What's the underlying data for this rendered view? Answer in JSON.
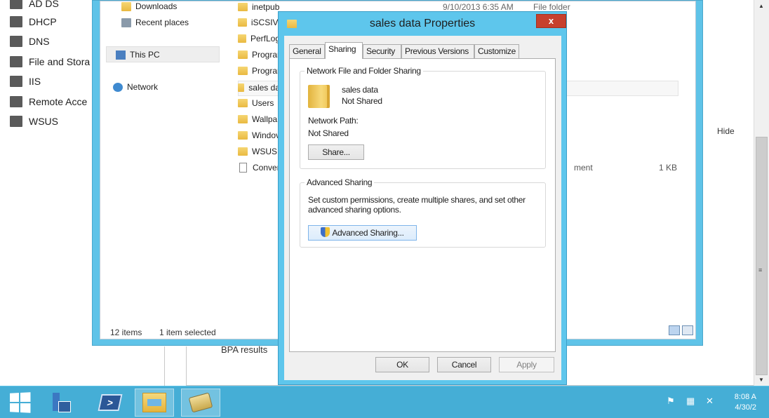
{
  "server_manager": {
    "nav_items": [
      {
        "label": "AD DS"
      },
      {
        "label": "DHCP"
      },
      {
        "label": "DNS"
      },
      {
        "label": "File and Stora"
      },
      {
        "label": "IIS"
      },
      {
        "label": "Remote Acce"
      },
      {
        "label": "WSUS"
      }
    ],
    "hide_label": "Hide",
    "bpa_label": "BPA results"
  },
  "explorer": {
    "nav": {
      "downloads": "Downloads",
      "recent_places": "Recent places",
      "this_pc": "This PC",
      "network": "Network"
    },
    "files": [
      {
        "name": "inetpub",
        "kind": "folder"
      },
      {
        "name": "iSCSIVi",
        "kind": "folder"
      },
      {
        "name": "PerfLog",
        "kind": "folder"
      },
      {
        "name": "Prograr",
        "kind": "folder"
      },
      {
        "name": "Prograr",
        "kind": "folder"
      },
      {
        "name": "sales da",
        "kind": "folder"
      },
      {
        "name": "Users",
        "kind": "folder"
      },
      {
        "name": "Wallpa",
        "kind": "folder"
      },
      {
        "name": "Windov",
        "kind": "folder"
      },
      {
        "name": "WSUS",
        "kind": "folder"
      },
      {
        "name": "Conver",
        "kind": "file"
      }
    ],
    "top_row_date": "9/10/2013 6:35 AM",
    "top_row_type": "File folder",
    "conv_type_partial": "ment",
    "conv_size": "1 KB",
    "status": {
      "item_count": "12 items",
      "selected": "1 item selected"
    }
  },
  "dialog": {
    "title": "sales data Properties",
    "close_glyph": "x",
    "tabs": [
      {
        "label": "General",
        "active": false
      },
      {
        "label": "Sharing",
        "active": true
      },
      {
        "label": "Security",
        "active": false
      },
      {
        "label": "Previous Versions",
        "active": false
      },
      {
        "label": "Customize",
        "active": false
      }
    ],
    "network_sharing": {
      "group_title": "Network File and Folder Sharing",
      "folder_name": "sales data",
      "share_state": "Not Shared",
      "path_label": "Network Path:",
      "path_value": "Not Shared",
      "share_button": "Share..."
    },
    "advanced_sharing": {
      "group_title": "Advanced Sharing",
      "description_line1": "Set custom permissions, create multiple shares, and set other",
      "description_line2": "advanced sharing options.",
      "button": "Advanced Sharing..."
    },
    "buttons": {
      "ok": "OK",
      "cancel": "Cancel",
      "apply": "Apply"
    }
  },
  "taskbar": {
    "apps": [
      {
        "name": "start"
      },
      {
        "name": "server-manager"
      },
      {
        "name": "powershell"
      },
      {
        "name": "file-explorer"
      },
      {
        "name": "misc-app"
      }
    ],
    "clock": {
      "time": "8:08 A",
      "date": "4/30/2"
    }
  }
}
